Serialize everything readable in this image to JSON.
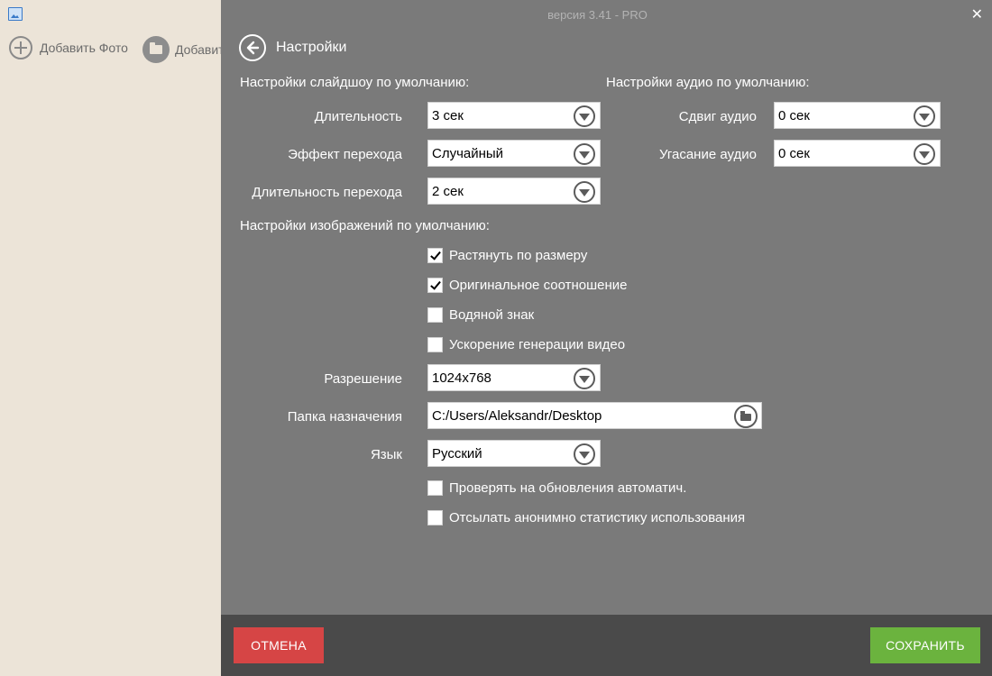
{
  "background_app": {
    "toolbar": {
      "add_photo_label": "Добавить Фото",
      "add_folder_label": "Добавит"
    }
  },
  "panel": {
    "version": "версия 3.41 - PRO",
    "title": "Настройки",
    "slideshow_section": "Настройки слайдшоу по умолчанию:",
    "audio_section": "Настройки аудио по умолчанию:",
    "image_section": "Настройки изображений по умолчанию:",
    "fields": {
      "duration": {
        "label": "Длительность",
        "value": "3 сек"
      },
      "transition_effect": {
        "label": "Эффект перехода",
        "value": "Случайный"
      },
      "transition_duration": {
        "label": "Длительность перехода",
        "value": "2 сек"
      },
      "audio_shift": {
        "label": "Сдвиг аудио",
        "value": "0 сек"
      },
      "audio_fade": {
        "label": "Угасание аудио",
        "value": "0 сек"
      },
      "resolution": {
        "label": "Разрешение",
        "value": "1024x768"
      },
      "destination": {
        "label": "Папка назначения",
        "value": "C:/Users/Aleksandr/Desktop"
      },
      "language": {
        "label": "Язык",
        "value": "Русский"
      }
    },
    "checkboxes": {
      "stretch": {
        "label": "Растянуть по размеру",
        "checked": true
      },
      "original_ratio": {
        "label": "Оригинальное соотношение",
        "checked": true
      },
      "watermark": {
        "label": "Водяной знак",
        "checked": false
      },
      "accelerate": {
        "label": "Ускорение генерации видео",
        "checked": false
      },
      "auto_update": {
        "label": "Проверять на обновления автоматич.",
        "checked": false
      },
      "send_stats": {
        "label": "Отсылать анонимно статистику использования",
        "checked": false
      }
    },
    "buttons": {
      "cancel": "ОТМЕНА",
      "save": "СОХРАНИТЬ"
    },
    "colors": {
      "panel_bg": "#7a7a7a",
      "footer_bg": "#4a4a4a",
      "cancel": "#d64545",
      "save": "#6bb33e",
      "app_bg": "#ece4d8"
    },
    "icons": {
      "back": "arrow-left-circle-icon",
      "close": "close-icon",
      "dropdown": "chevron-down-circle-icon",
      "folder": "folder-icon"
    }
  }
}
